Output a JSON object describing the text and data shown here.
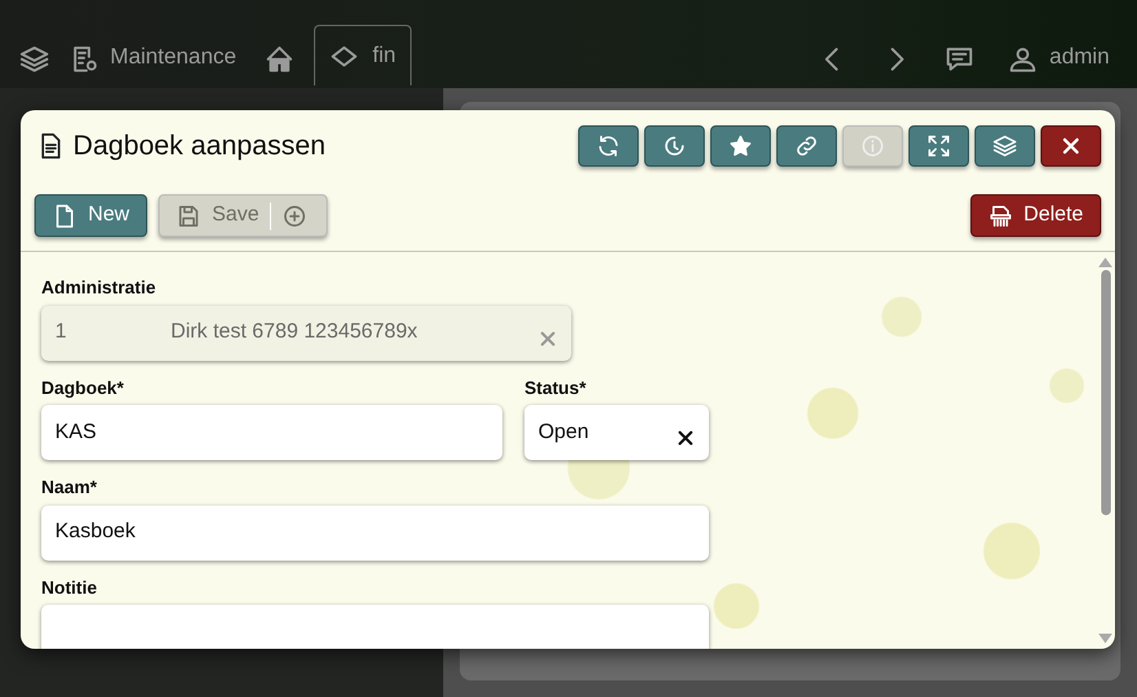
{
  "navbar": {
    "module_label": "Maintenance",
    "tab": {
      "label": "fin",
      "selected": true
    },
    "user": "admin"
  },
  "dialog": {
    "title": "Dagboek aanpassen",
    "toolbar": [
      {
        "kind": "refresh",
        "disabled": false
      },
      {
        "kind": "history",
        "disabled": false
      },
      {
        "kind": "star",
        "disabled": false
      },
      {
        "kind": "link",
        "disabled": false
      },
      {
        "kind": "info",
        "disabled": true
      },
      {
        "kind": "expand",
        "disabled": false
      },
      {
        "kind": "layers",
        "disabled": false
      },
      {
        "kind": "close",
        "disabled": false
      }
    ],
    "actions": [
      {
        "kind": "new",
        "label": "New",
        "disabled": false
      },
      {
        "kind": "save",
        "label": "Save",
        "disabled": true
      },
      {
        "kind": "delete",
        "label": "Delete",
        "disabled": false
      }
    ],
    "form_rows": [
      [
        {
          "kind": "lookup",
          "label": "Administratie",
          "code": "1",
          "value": "Dirk test 6789 123456789x",
          "disabled": true
        }
      ],
      [
        {
          "kind": "text",
          "label": "Dagboek*",
          "value": "KAS",
          "disabled": false
        },
        {
          "kind": "select",
          "label": "Status*",
          "value": "Open",
          "disabled": false
        }
      ],
      [
        {
          "kind": "text",
          "label": "Naam*",
          "value": "Kasboek",
          "disabled": false
        }
      ],
      [
        {
          "kind": "textarea",
          "label": "Notitie",
          "disabled": false
        }
      ]
    ]
  }
}
